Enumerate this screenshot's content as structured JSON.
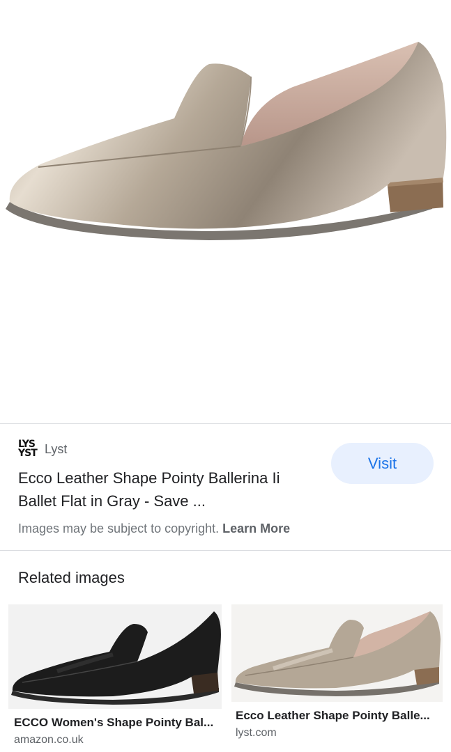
{
  "hero": {
    "image_name": "metallic-loafer-image"
  },
  "source": {
    "logo_text_line1": "LYS",
    "logo_text_line2": "YST",
    "name": "Lyst"
  },
  "result": {
    "title": "Ecco Leather Shape Pointy Ballerina Ii Ballet Flat in Gray - Save ...",
    "visit_label": "Visit"
  },
  "copyright": {
    "text": "Images may be subject to copyright.",
    "learn_more": "Learn More"
  },
  "related": {
    "heading": "Related images",
    "items": [
      {
        "title": "ECCO Women's Shape Pointy Bal...",
        "source": "amazon.co.uk"
      },
      {
        "title": "Ecco Leather Shape Pointy Balle...",
        "source": "lyst.com"
      }
    ]
  },
  "colors": {
    "visit_bg": "#e8f0fe",
    "visit_text": "#1a73e8",
    "divider": "#dadce0"
  }
}
